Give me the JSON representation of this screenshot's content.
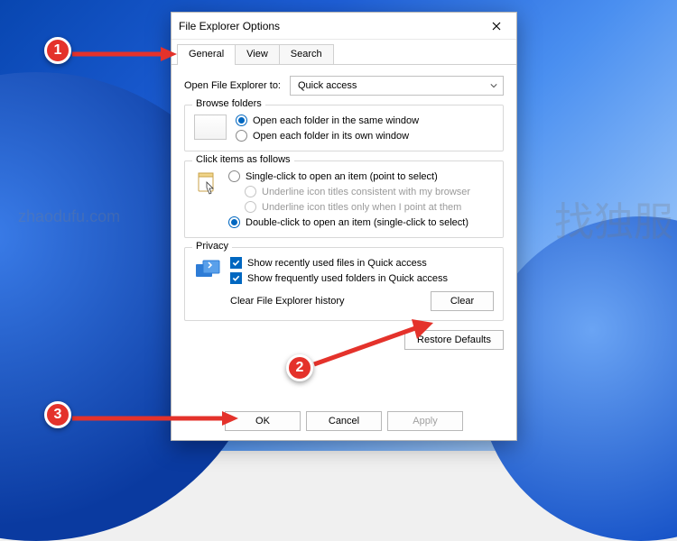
{
  "dialog": {
    "title": "File Explorer Options",
    "tabs": [
      "General",
      "View",
      "Search"
    ],
    "open_label": "Open File Explorer to:",
    "open_value": "Quick access",
    "browse": {
      "legend": "Browse folders",
      "opt_same": "Open each folder in the same window",
      "opt_own": "Open each folder in its own window"
    },
    "click": {
      "legend": "Click items as follows",
      "opt_single": "Single-click to open an item (point to select)",
      "opt_underline_browser": "Underline icon titles consistent with my browser",
      "opt_underline_point": "Underline icon titles only when I point at them",
      "opt_double": "Double-click to open an item (single-click to select)"
    },
    "privacy": {
      "legend": "Privacy",
      "recent_files": "Show recently used files in Quick access",
      "frequent_folders": "Show frequently used folders in Quick access",
      "clear_label": "Clear File Explorer history",
      "clear_btn": "Clear"
    },
    "restore_defaults": "Restore Defaults",
    "ok": "OK",
    "cancel": "Cancel",
    "apply": "Apply"
  },
  "annotations": {
    "b1": "1",
    "b2": "2",
    "b3": "3"
  },
  "watermark": {
    "url": "zhaodufu.com",
    "cn": "找独服"
  }
}
